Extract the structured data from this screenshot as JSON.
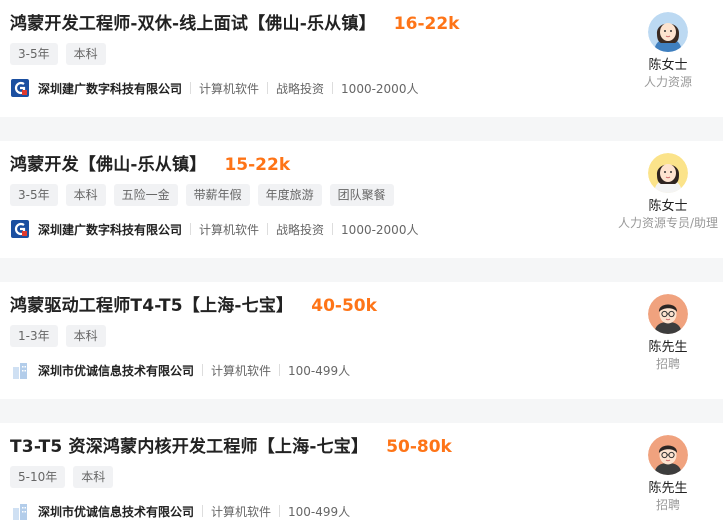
{
  "jobs": [
    {
      "title": "鸿蒙开发工程师-双休-线上面试【佛山-乐从镇】",
      "salary": "16-22k",
      "tags": [
        "3-5年",
        "本科"
      ],
      "company": "深圳建广数字科技有限公司",
      "meta": [
        "计算机软件",
        "战略投资",
        "1000-2000人"
      ],
      "logo": "company-logo-blue-g",
      "recruiter": {
        "name": "陈女士",
        "role": "人力资源",
        "avatar": "female-avatar-blue"
      }
    },
    {
      "title": "鸿蒙开发【佛山-乐从镇】",
      "salary": "15-22k",
      "tags": [
        "3-5年",
        "本科",
        "五险一金",
        "带薪年假",
        "年度旅游",
        "团队聚餐"
      ],
      "company": "深圳建广数字科技有限公司",
      "meta": [
        "计算机软件",
        "战略投资",
        "1000-2000人"
      ],
      "logo": "company-logo-blue-g",
      "recruiter": {
        "name": "陈女士",
        "role": "人力资源专员/助理",
        "avatar": "female-avatar-yellow"
      }
    },
    {
      "title": "鸿蒙驱动工程师T4-T5【上海-七宝】",
      "salary": "40-50k",
      "tags": [
        "1-3年",
        "本科"
      ],
      "company": "深圳市优诚信息技术有限公司",
      "meta": [
        "计算机软件",
        "100-499人"
      ],
      "logo": "company-logo-buildings",
      "recruiter": {
        "name": "陈先生",
        "role": "招聘",
        "avatar": "male-avatar-orange"
      }
    },
    {
      "title": "T3-T5 资深鸿蒙内核开发工程师【上海-七宝】",
      "salary": "50-80k",
      "tags": [
        "5-10年",
        "本科"
      ],
      "company": "深圳市优诚信息技术有限公司",
      "meta": [
        "计算机软件",
        "100-499人"
      ],
      "logo": "company-logo-buildings",
      "recruiter": {
        "name": "陈先生",
        "role": "招聘",
        "avatar": "male-avatar-orange"
      }
    }
  ],
  "colors": {
    "salary": "#fe7417",
    "tag_bg": "#f1f2f4",
    "page_bg": "#f5f6f7"
  }
}
